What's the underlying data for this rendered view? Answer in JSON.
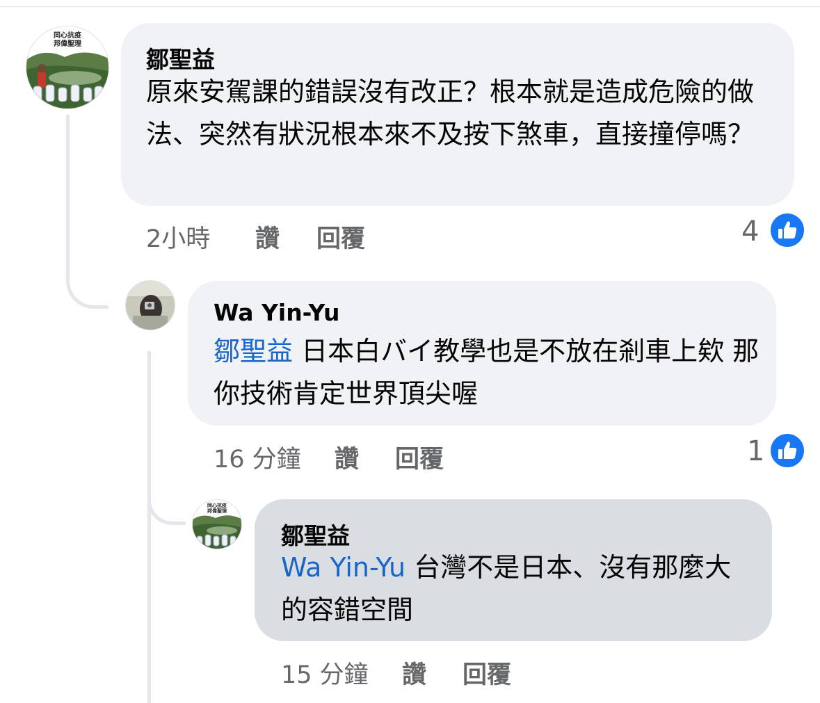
{
  "comments": [
    {
      "author": "鄒聖益",
      "text": "原來安駕課的錯誤沒有改正？根本就是造成危險的做法、突然有狀況根本來不及按下煞車，直接撞停嗎？",
      "time": "2小時",
      "like_label": "讚",
      "reply_label": "回覆",
      "reaction_count": "4",
      "avatar_caption": "同心抗疫 邦偉聖理"
    },
    {
      "author": "Wa Yin-Yu",
      "mention": "鄒聖益",
      "text": " 日本白バイ教學也是不放在剎車上欸 那你技術肯定世界頂尖喔",
      "time": "16 分鐘",
      "like_label": "讚",
      "reply_label": "回覆",
      "reaction_count": "1"
    },
    {
      "author": "鄒聖益",
      "mention": "Wa Yin-Yu",
      "text": " 台灣不是日本、沒有那麼大的容錯空間",
      "time": "15 分鐘",
      "like_label": "讚",
      "reply_label": "回覆",
      "avatar_caption": "同心抗疫 邦偉聖理"
    }
  ],
  "colors": {
    "bubble": "#f0f2f5",
    "bubble_highlight": "#dadde1",
    "mention": "#1766c8",
    "like_badge": "#1877f2"
  },
  "icons": [
    "thumbs-up-icon",
    "reply-thread-line"
  ]
}
